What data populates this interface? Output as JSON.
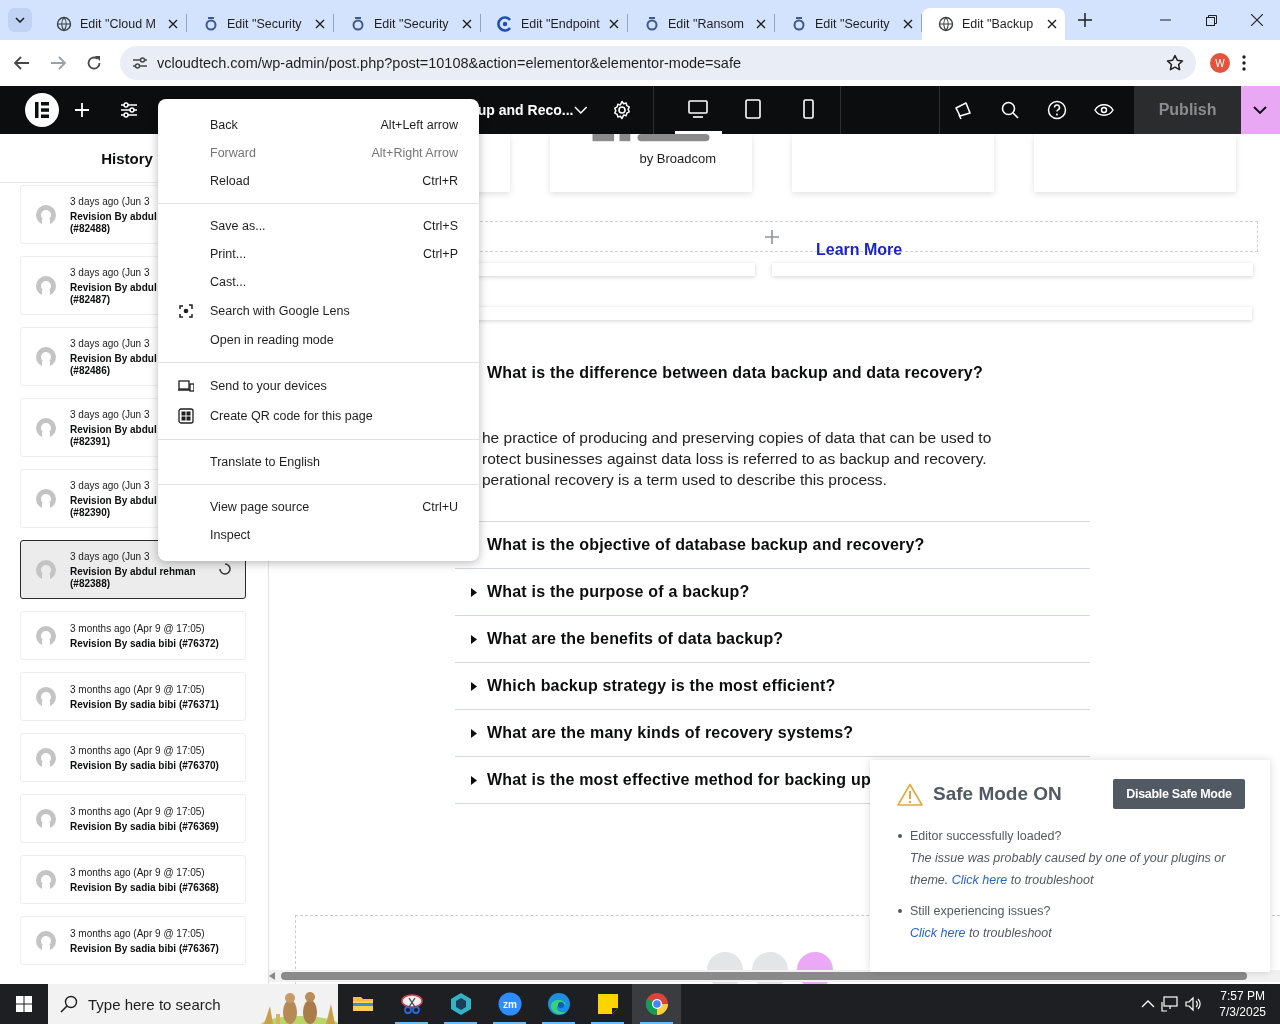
{
  "browser": {
    "tabs": [
      {
        "label": "Edit \"Cloud M",
        "kind": "globe",
        "selected": false
      },
      {
        "label": "Edit \"Security",
        "kind": "swirl",
        "selected": false
      },
      {
        "label": "Edit \"Security",
        "kind": "swirl",
        "selected": false
      },
      {
        "label": "Edit \"Endpoint",
        "kind": "ring",
        "selected": false
      },
      {
        "label": "Edit \"Ransom",
        "kind": "swirl",
        "selected": false
      },
      {
        "label": "Edit \"Security",
        "kind": "swirl",
        "selected": false
      },
      {
        "label": "Edit \"Backup",
        "kind": "globe",
        "selected": true
      }
    ],
    "url": "vcloudtech.com/wp-admin/post.php?post=10108&action=elementor&elementor-mode=safe",
    "profile": "W"
  },
  "editor": {
    "title": "up and Reco...",
    "devices": [
      {
        "kind": "desktop",
        "selected": true
      },
      {
        "kind": "tablet",
        "selected": false
      },
      {
        "kind": "mobile",
        "selected": false
      }
    ],
    "publish": {
      "label": "Publish",
      "disabled": true
    }
  },
  "history": {
    "title": "History",
    "revisions": [
      {
        "time": "3 days ago (Jun 3",
        "author": "Revision By abdul",
        "id": "(#82488)",
        "selected": false,
        "loading": false
      },
      {
        "time": "3 days ago (Jun 3",
        "author": "Revision By abdul",
        "id": "(#82487)",
        "selected": false,
        "loading": false
      },
      {
        "time": "3 days ago (Jun 3",
        "author": "Revision By abdul",
        "id": "(#82486)",
        "selected": false,
        "loading": false
      },
      {
        "time": "3 days ago (Jun 3",
        "author": "Revision By abdul",
        "id": "(#82391)",
        "selected": false,
        "loading": false
      },
      {
        "time": "3 days ago (Jun 3",
        "author": "Revision By abdul",
        "id": "(#82390)",
        "selected": false,
        "loading": false
      },
      {
        "time": "3 days ago (Jun 3",
        "author": "Revision By abdul rehman",
        "id": "(#82388)",
        "selected": true,
        "loading": true
      },
      {
        "time": "3 months ago (Apr 9 @ 17:05)",
        "author": "Revision By sadia bibi (#76372)",
        "selected": false,
        "loading": false
      },
      {
        "time": "3 months ago (Apr 9 @ 17:05)",
        "author": "Revision By sadia bibi (#76371)",
        "selected": false,
        "loading": false
      },
      {
        "time": "3 months ago (Apr 9 @ 17:05)",
        "author": "Revision By sadia bibi (#76370)",
        "selected": false,
        "loading": false
      },
      {
        "time": "3 months ago (Apr 9 @ 17:05)",
        "author": "Revision By sadia bibi (#76369)",
        "selected": false,
        "loading": false
      },
      {
        "time": "3 months ago (Apr 9 @ 17:05)",
        "author": "Revision By sadia bibi (#76368)",
        "selected": false,
        "loading": false
      },
      {
        "time": "3 months ago (Apr 9 @ 17:05)",
        "author": "Revision By sadia bibi (#76367)",
        "selected": false,
        "loading": false
      }
    ]
  },
  "canvas": {
    "logo_caption": "by Broadcom",
    "link": "Learn More",
    "faq": [
      {
        "question": "What is the difference between data backup and data recovery?",
        "expanded": true,
        "answer_lines": [
          "he practice of producing and preserving copies of data that can be used to",
          "rotect businesses against data loss is referred to as backup and recovery.",
          "perational recovery is a term used to describe this process."
        ]
      },
      {
        "question": "What is the objective of database backup and recovery?",
        "expanded": false
      },
      {
        "question": "What is the purpose of a backup?",
        "expanded": false
      },
      {
        "question": "What are the benefits of data backup?",
        "expanded": false
      },
      {
        "question": "Which backup strategy is the most efficient?",
        "expanded": false
      },
      {
        "question": "What are the many kinds of recovery systems?",
        "expanded": false
      },
      {
        "question": "What is the most effective method for backing up",
        "expanded": false
      }
    ]
  },
  "context_menu": {
    "groups": [
      {
        "items": [
          {
            "label": "Back",
            "shortcut": "Alt+Left arrow",
            "kind": "plain",
            "disabled": false
          },
          {
            "label": "Forward",
            "shortcut": "Alt+Right Arrow",
            "kind": "plain",
            "disabled": true
          },
          {
            "label": "Reload",
            "shortcut": "Ctrl+R",
            "kind": "plain",
            "disabled": false
          }
        ]
      },
      {
        "items": [
          {
            "label": "Save as...",
            "shortcut": "Ctrl+S",
            "kind": "plain",
            "disabled": false
          },
          {
            "label": "Print...",
            "shortcut": "Ctrl+P",
            "kind": "plain",
            "disabled": false
          },
          {
            "label": "Cast...",
            "kind": "plain",
            "disabled": false
          },
          {
            "label": "Search with Google Lens",
            "kind": "lens",
            "disabled": false
          },
          {
            "label": "Open in reading mode",
            "kind": "plain",
            "disabled": false
          }
        ]
      },
      {
        "items": [
          {
            "label": "Send to your devices",
            "kind": "devices",
            "disabled": false
          },
          {
            "label": "Create QR code for this page",
            "kind": "qr",
            "disabled": false
          }
        ]
      },
      {
        "items": [
          {
            "label": "Translate to English",
            "kind": "plain",
            "disabled": false
          }
        ]
      },
      {
        "items": [
          {
            "label": "View page source",
            "shortcut": "Ctrl+U",
            "kind": "plain",
            "disabled": false
          },
          {
            "label": "Inspect",
            "kind": "plain",
            "disabled": false
          }
        ]
      }
    ]
  },
  "safe_mode": {
    "title": "Safe Mode ON",
    "button": "Disable Safe Mode",
    "notes": [
      {
        "title": "Editor successfully loaded?",
        "text": "The issue was probably caused by one of your plugins or theme.",
        "link": "Click here",
        "after": "to troubleshoot"
      },
      {
        "title": "Still experiencing issues?",
        "link": "Click here",
        "after": "to troubleshoot"
      }
    ]
  },
  "taskbar": {
    "search_placeholder": "Type here to search",
    "apps": [
      {
        "kind": "folder",
        "running": false,
        "active": false
      },
      {
        "kind": "snip",
        "running": true,
        "active": false
      },
      {
        "kind": "hex",
        "running": true,
        "active": false
      },
      {
        "kind": "zoom",
        "label": "zm",
        "running": true,
        "active": false
      },
      {
        "kind": "edge",
        "running": true,
        "active": false
      },
      {
        "kind": "notes",
        "running": true,
        "active": false
      },
      {
        "kind": "chrome",
        "running": true,
        "active": true
      }
    ],
    "time": "7:57 PM",
    "date": "7/3/2025"
  }
}
